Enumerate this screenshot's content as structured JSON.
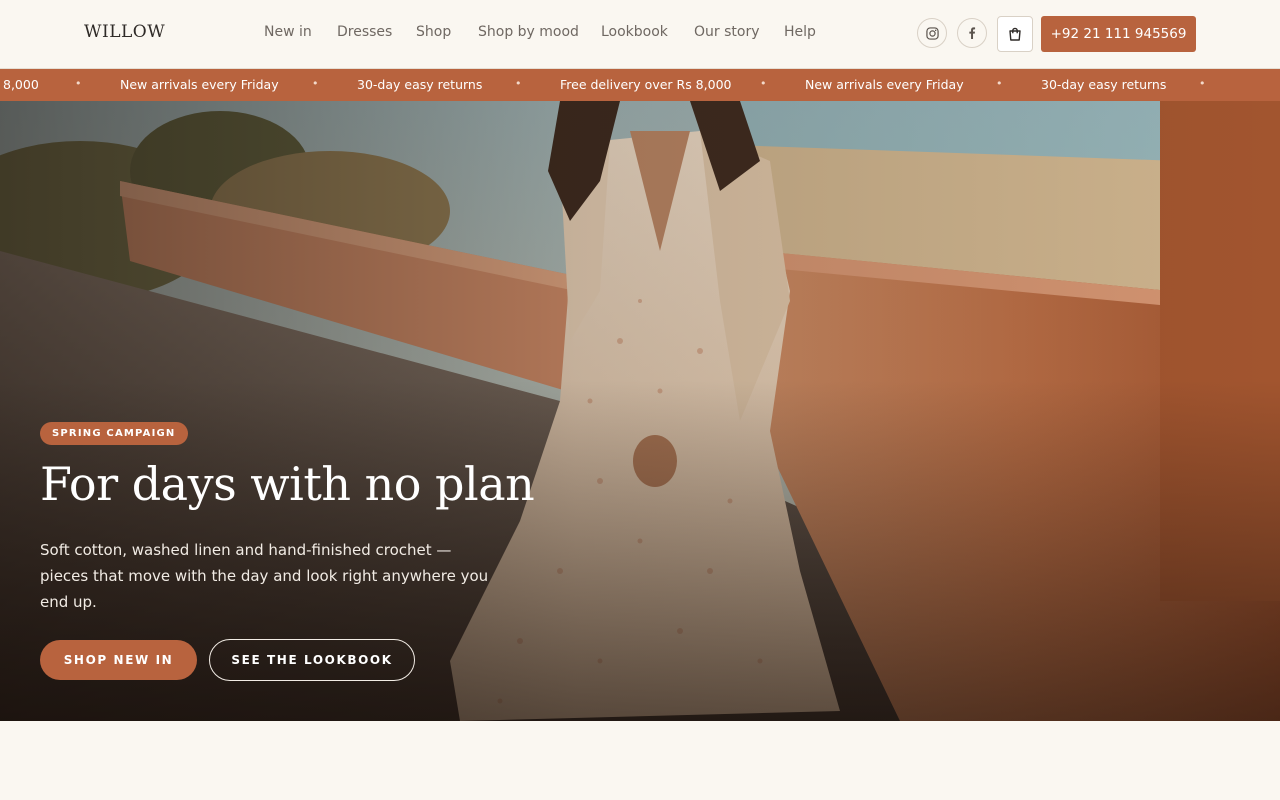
{
  "brand": {
    "logo": "WILLOW"
  },
  "nav": {
    "items": [
      "New in",
      "Dresses",
      "Shop",
      "Shop by mood",
      "Lookbook",
      "Our story",
      "Help"
    ]
  },
  "header": {
    "phone": "+92 21 111 945569",
    "icons": [
      "instagram-icon",
      "facebook-icon",
      "shopping-bag-icon"
    ]
  },
  "ticker": {
    "items": [
      "8,000",
      "New arrivals every Friday",
      "30-day easy returns",
      "Free delivery over Rs 8,000",
      "New arrivals every Friday",
      "30-day easy returns"
    ],
    "separator": "•"
  },
  "hero": {
    "badge": "SPRING CAMPAIGN",
    "title": "For days with no plan",
    "subtitle": "Soft cotton, washed linen and hand-finished crochet — pieces that move with the day and look right anywhere you end up.",
    "primary_cta": "SHOP NEW IN",
    "secondary_cta": "SEE THE LOOKBOOK"
  },
  "colors": {
    "accent": "#b8633e",
    "background": "#faf7f1",
    "text_dark": "#2e2a27",
    "nav_text": "#6f6862"
  }
}
